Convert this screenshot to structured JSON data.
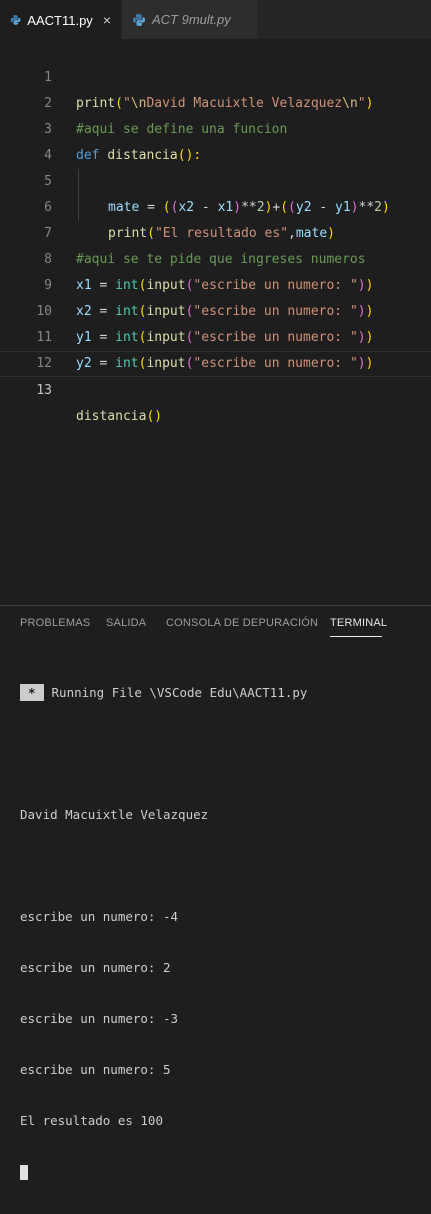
{
  "tabs": [
    {
      "label": "AACT11.py",
      "active": true,
      "close_glyph": "×",
      "icon": "python-icon"
    },
    {
      "label": "ACT 9mult.py",
      "active": false,
      "icon": "python-icon"
    }
  ],
  "editor": {
    "current_line": 13,
    "lines": [
      {
        "n": "1"
      },
      {
        "n": "2"
      },
      {
        "n": "3"
      },
      {
        "n": "4"
      },
      {
        "n": "5"
      },
      {
        "n": "6"
      },
      {
        "n": "7"
      },
      {
        "n": "8"
      },
      {
        "n": "9"
      },
      {
        "n": "10"
      },
      {
        "n": "11"
      },
      {
        "n": "12"
      },
      {
        "n": "13"
      }
    ],
    "tokens": {
      "l1": [
        "print",
        "(",
        "\"",
        "\\n",
        "David Macuixtle Velazquez",
        "\\n",
        "\"",
        ")"
      ],
      "l2": "#aqui se define una funcion",
      "l3": [
        "def",
        " ",
        "distancia",
        "():"
      ],
      "l4": [
        "mate",
        " = ",
        "(",
        "(",
        "x2",
        " - ",
        "x1",
        ")",
        "**",
        "2",
        ")",
        "+",
        "(",
        "(",
        "y2",
        " - ",
        "y1",
        ")",
        "**",
        "2",
        ")"
      ],
      "l5": [
        "print",
        "(",
        "\"El resultado es\"",
        ",",
        "mate",
        ")"
      ],
      "l7": "#aqui se te pide que ingreses numeros",
      "l8": [
        "x1",
        " = ",
        "int",
        "(",
        "input",
        "(",
        "\"escribe un numero: \"",
        ")",
        ")"
      ],
      "l9": [
        "x2",
        " = ",
        "int",
        "(",
        "input",
        "(",
        "\"escribe un numero: \"",
        ")",
        ")"
      ],
      "l10": [
        "y1",
        " = ",
        "int",
        "(",
        "input",
        "(",
        "\"escribe un numero: \"",
        ")",
        ")"
      ],
      "l11": [
        "y2",
        " = ",
        "int",
        "(",
        "input",
        "(",
        "\"escribe un numero: \"",
        ")",
        ")"
      ],
      "l13": [
        "distancia",
        "()"
      ]
    }
  },
  "panel": {
    "tabs": [
      "PROBLEMAS",
      "SALIDA",
      "CONSOLA DE DEPURACIÓN",
      "TERMINAL"
    ],
    "active_tab": "TERMINAL",
    "terminal": {
      "badge": "*",
      "running": "Running File \\VSCode Edu\\AACT11.py",
      "output": [
        "David Macuixtle Velazquez",
        "escribe un numero: -4",
        "escribe un numero: 2",
        "escribe un numero: -3",
        "escribe un numero: 5",
        "El resultado es 100"
      ]
    }
  },
  "colors": {
    "background": "#1e1e1e",
    "tabbar": "#252526",
    "function": "#dcdcaa",
    "string": "#ce9178",
    "comment": "#6a9955",
    "keyword": "#569cd6",
    "variable": "#9cdcfe"
  }
}
